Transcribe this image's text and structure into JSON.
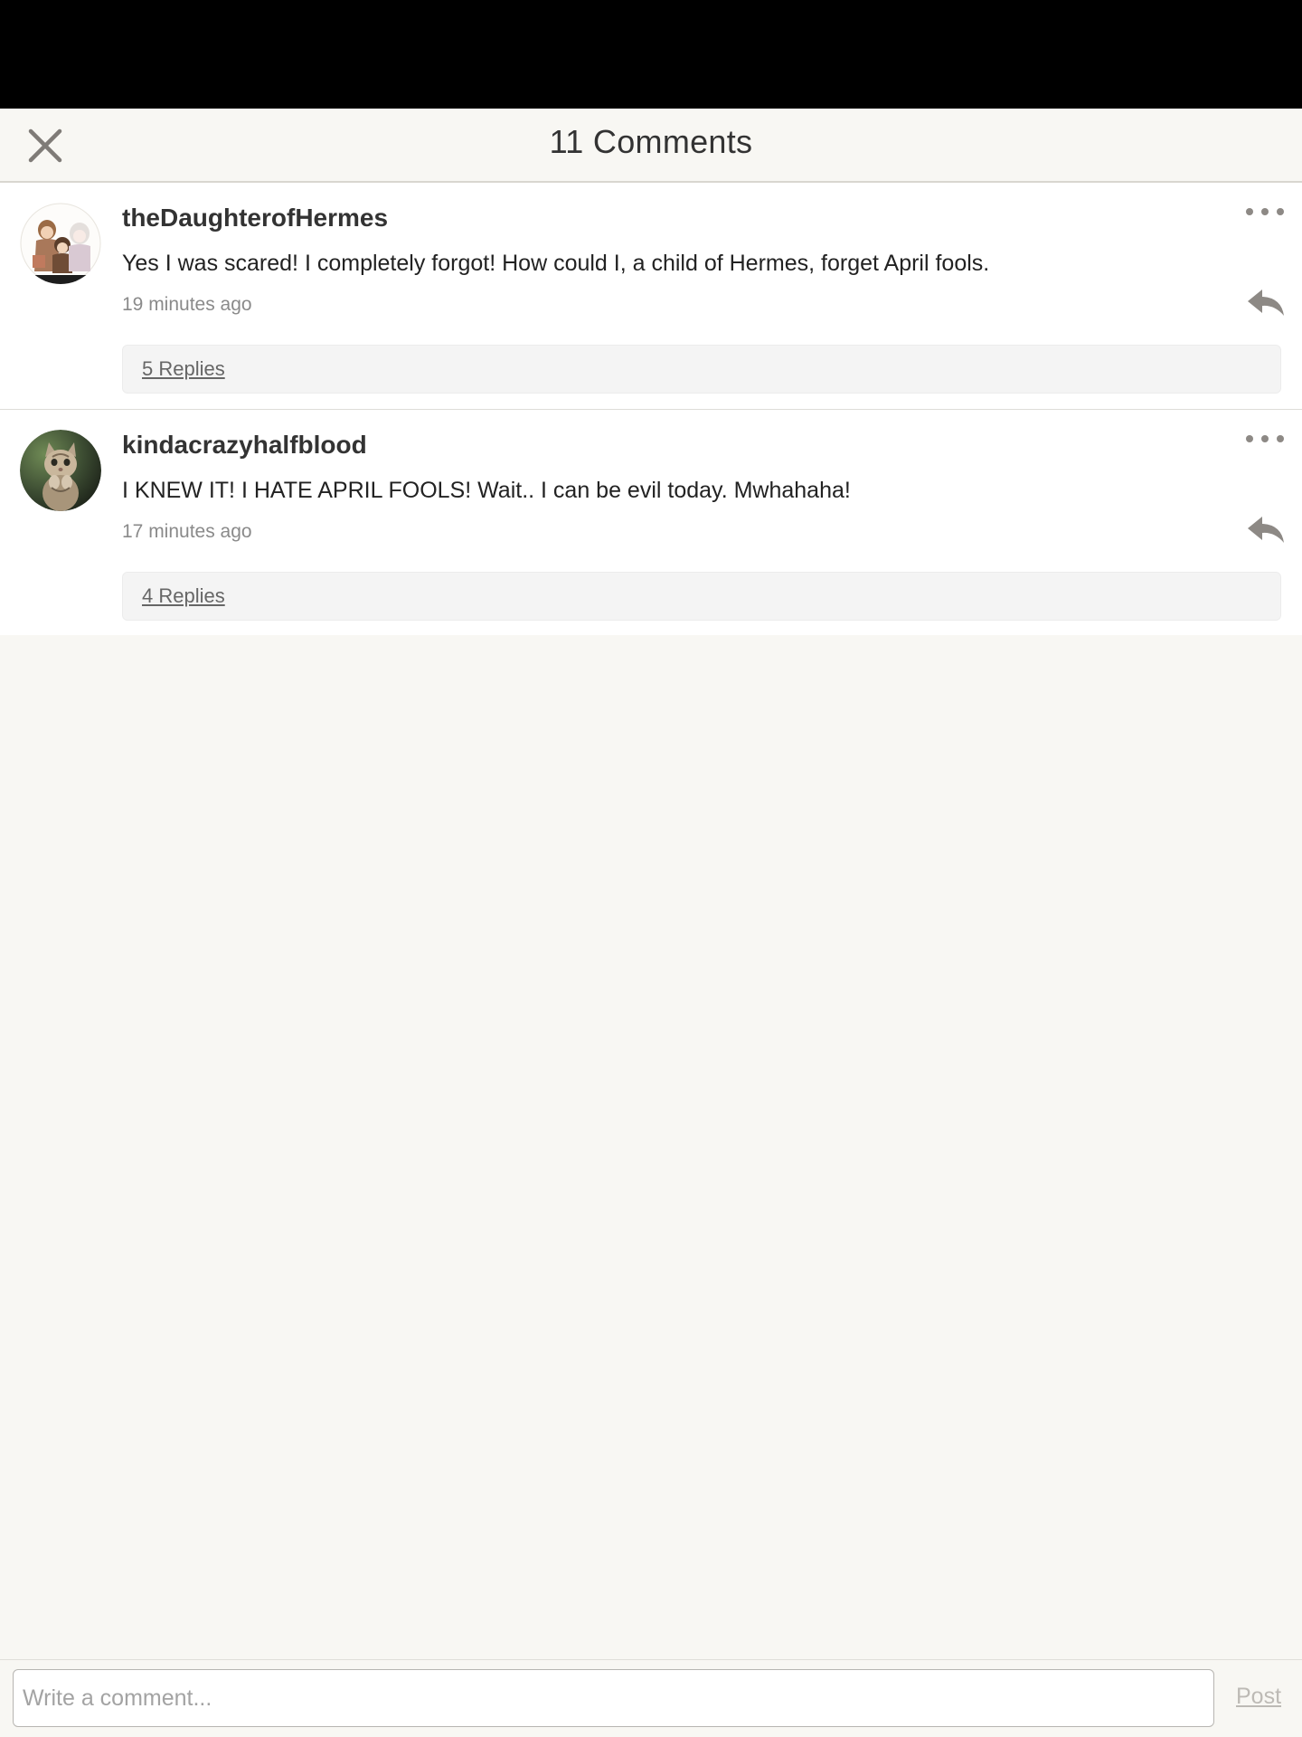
{
  "header": {
    "title": "11 Comments",
    "close_icon": "close-icon"
  },
  "comments": [
    {
      "username": "theDaughterofHermes",
      "text": "Yes I was scared! I completely forgot! How could I, a child of Hermes, forget April fools.",
      "time": "19 minutes ago",
      "replies_label": "5 Replies",
      "avatar": "anime-characters-avatar"
    },
    {
      "username": "kindacrazyhalfblood",
      "text": "I KNEW IT! I HATE APRIL FOOLS! Wait.. I can be evil today. Mwhahaha!",
      "time": "17 minutes ago",
      "replies_label": "4 Replies",
      "avatar": "kitten-photo-avatar"
    }
  ],
  "composer": {
    "placeholder": "Write a comment...",
    "post_label": "Post"
  },
  "colors": {
    "background": "#f8f7f3",
    "icon_gray": "#8d8985",
    "muted_text": "#8a8a8a"
  }
}
